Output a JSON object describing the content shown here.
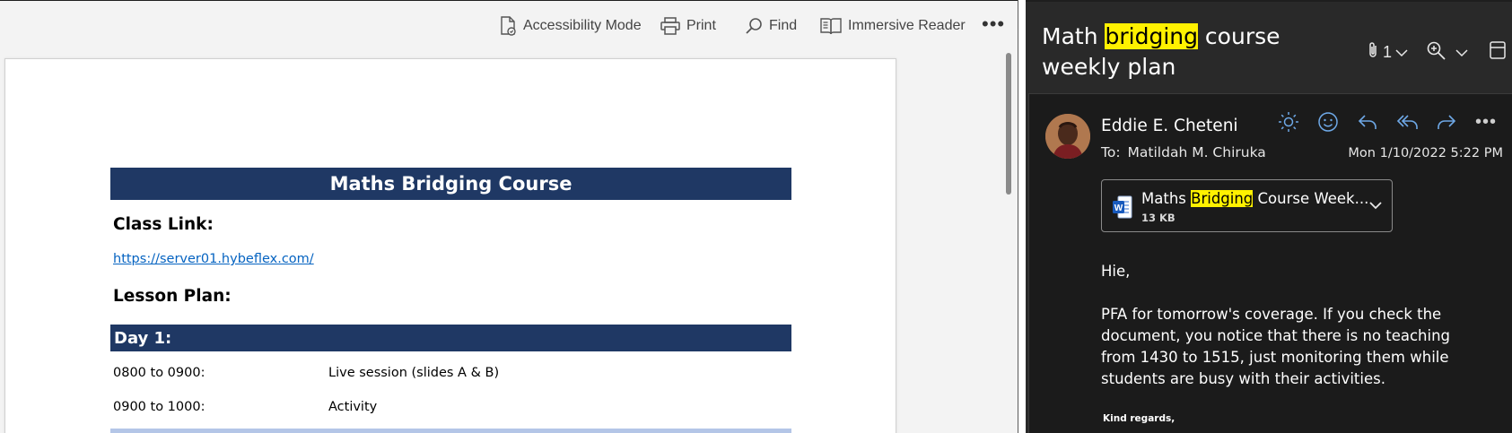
{
  "toolbar": {
    "accessibility_label": "Accessibility Mode",
    "print_label": "Print",
    "find_label": "Find",
    "immersive_label": "Immersive Reader",
    "more_label": "•••"
  },
  "document": {
    "title": "Maths Bridging Course",
    "class_link_label": "Class Link:",
    "class_link_url": "https://server01.hybeflex.com/",
    "lesson_plan_label": "Lesson Plan:",
    "day_label": "Day 1:",
    "schedule": [
      {
        "time": "0800 to 0900:",
        "activity": "Live session (slides A & B)"
      },
      {
        "time": "0900 to 1000:",
        "activity": "Activity"
      }
    ]
  },
  "email": {
    "subject_pre": "Math ",
    "subject_highlight": "bridging",
    "subject_post": " course weekly plan",
    "attachment_count": "1",
    "sender": "Eddie E. Cheteni",
    "to_label": "To:",
    "recipient": "Matildah M. Chiruka",
    "date": "Mon 1/10/2022 5:22 PM",
    "attachment": {
      "name_pre": "Maths ",
      "name_highlight": "Bridging",
      "name_post": " Course Week...",
      "size": "13 KB"
    },
    "greeting": "Hie,",
    "body": "PFA for tomorrow's coverage. If you check the document, you notice that there is no teaching from 1430 to 1515, just monitoring them while students are busy with their activities.",
    "signoff": "Kind regards,"
  },
  "colors": {
    "doc_header_bg": "#1f3864",
    "highlight": "#fff100",
    "mail_bg": "#292929",
    "action_icon": "#6ea8e6"
  }
}
